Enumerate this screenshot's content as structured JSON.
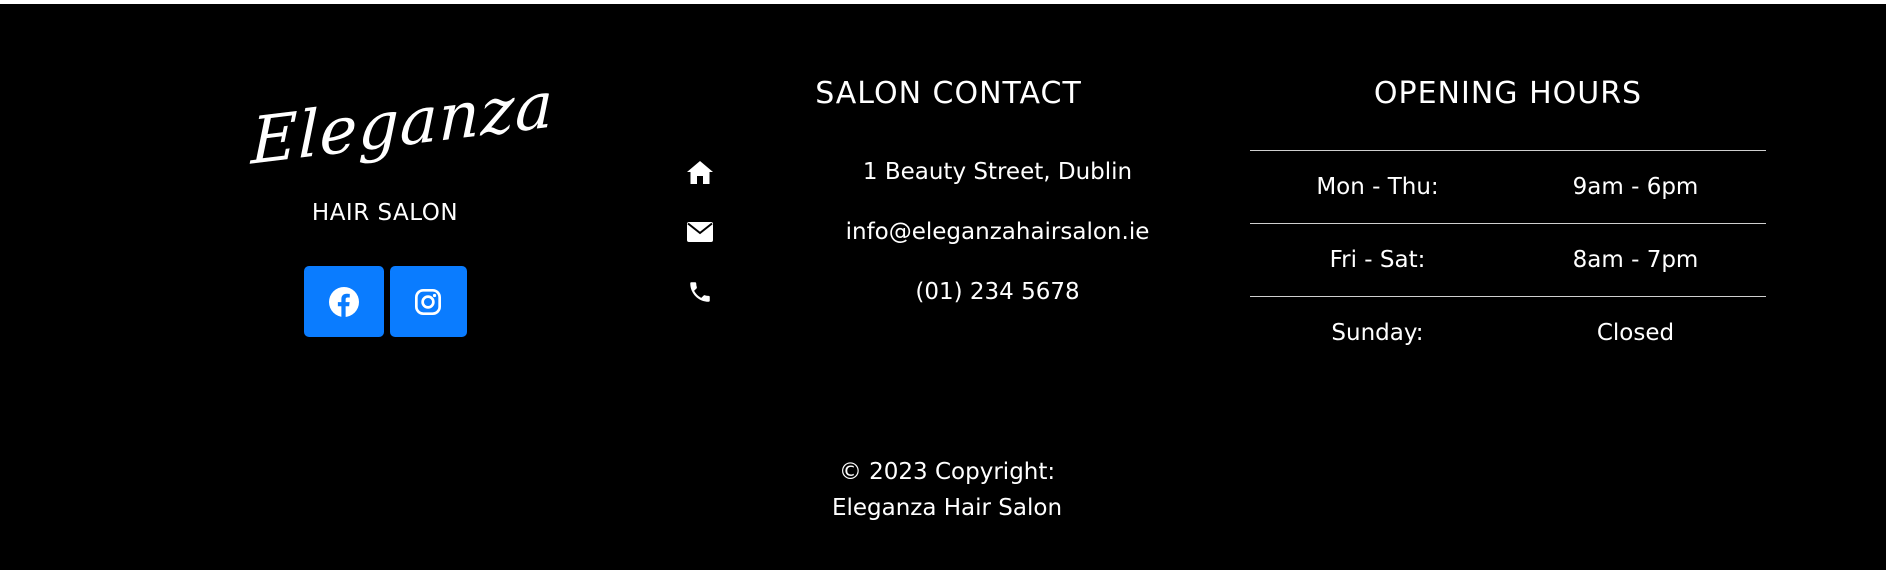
{
  "brand": {
    "logo_text": "Eleganza",
    "subtitle": "HAIR SALON",
    "socials": [
      {
        "icon": "facebook-icon",
        "color": "#0a7cff"
      },
      {
        "icon": "instagram-icon",
        "color": "#0a7cff"
      }
    ]
  },
  "contact": {
    "title": "SALON CONTACT",
    "items": [
      {
        "icon": "home-icon",
        "text": "1 Beauty Street, Dublin"
      },
      {
        "icon": "envelope-icon",
        "text": "info@eleganzahairsalon.ie"
      },
      {
        "icon": "phone-icon",
        "text": "(01) 234 5678"
      }
    ]
  },
  "hours": {
    "title": "OPENING HOURS",
    "rows": [
      {
        "day": "Mon - Thu:",
        "time": "9am - 6pm"
      },
      {
        "day": "Fri - Sat:",
        "time": "8am - 7pm"
      },
      {
        "day": "Sunday:",
        "time": "Closed"
      }
    ]
  },
  "copyright": {
    "line1": "© 2023 Copyright:",
    "line2": "Eleganza Hair Salon"
  },
  "colors": {
    "background": "#000000",
    "text": "#ffffff",
    "social_button": "#0a7cff",
    "divider": "#cfcfcf"
  }
}
